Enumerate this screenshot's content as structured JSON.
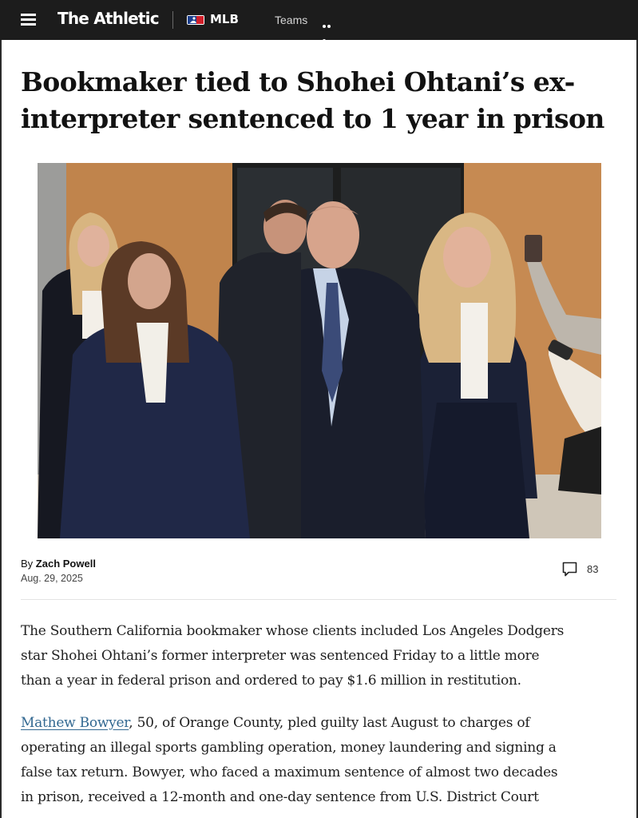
{
  "nav": {
    "brand": "The Athletic",
    "league": "MLB",
    "teams_label": "Teams"
  },
  "article": {
    "headline_line1": "Bookmaker tied to Shohei Ohtani’s ex-",
    "headline_line2": "interpreter sentenced to 1 year in prison",
    "byline_prefix": "By ",
    "author": "Zach Powell",
    "date": "Aug. 29, 2025",
    "comment_count": "83",
    "paragraph1_line1": "The Southern California bookmaker whose clients included Los Angeles Dodgers",
    "paragraph1_line2": "star Shohei Ohtani’s former interpreter was sentenced Friday to a little more",
    "paragraph1_line3": "than a year in federal prison and ordered to pay $1.6 million in restitution.",
    "paragraph2_link": "Mathew Bowyer",
    "paragraph2_line1_rest": ", 50, of Orange County, pled guilty last August to charges of",
    "paragraph2_line2": "operating an illegal sports gambling operation, money laundering and signing a",
    "paragraph2_line3": "false tax return. Bowyer, who faced a maximum sentence of almost two decades",
    "paragraph2_line4": "in prison, received a 12-month and one-day sentence from U.S. District Court"
  },
  "icons": {
    "menu": "hamburger-menu-icon",
    "mlb": "mlb-logo-icon",
    "more": "more-horizontal-icon",
    "comment": "comment-bubble-icon"
  },
  "colors": {
    "topbar": "#1c1c1c",
    "link": "#326891",
    "text": "#1f1f1f"
  }
}
